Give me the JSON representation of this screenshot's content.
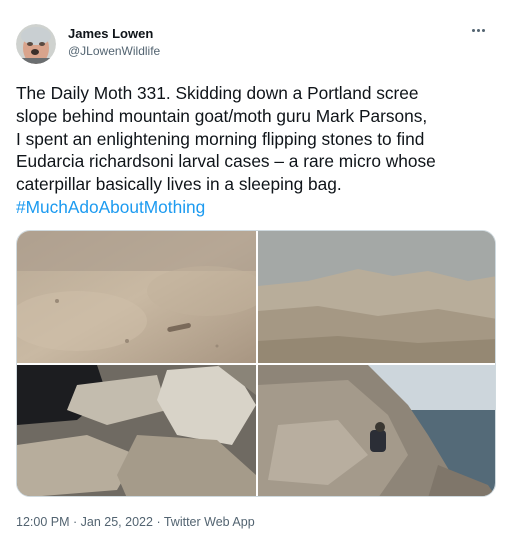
{
  "tweet": {
    "author": {
      "display_name": "James Lowen",
      "handle": "@JLowenWildlife"
    },
    "text_lines": [
      "The Daily Moth 331. Skidding down a Portland scree",
      "slope behind mountain goat/moth guru Mark Parsons,",
      "I spent an enlightening morning flipping stones to find",
      "Eudarcia richardsoni larval cases – a rare micro whose",
      "caterpillar basically lives in a sleeping bag."
    ],
    "hashtag": "#MuchAdoAboutMothing",
    "time": "12:00 PM",
    "separator": "·",
    "date": "Jan 25, 2022",
    "source": "Twitter Web App",
    "photos_count": 4
  },
  "colors": {
    "link": "#1d9bf0",
    "secondary_text": "#536471",
    "primary_text": "#0f1419",
    "border": "#cfd9de"
  },
  "icons": {
    "more": "more-horizontal-icon"
  }
}
